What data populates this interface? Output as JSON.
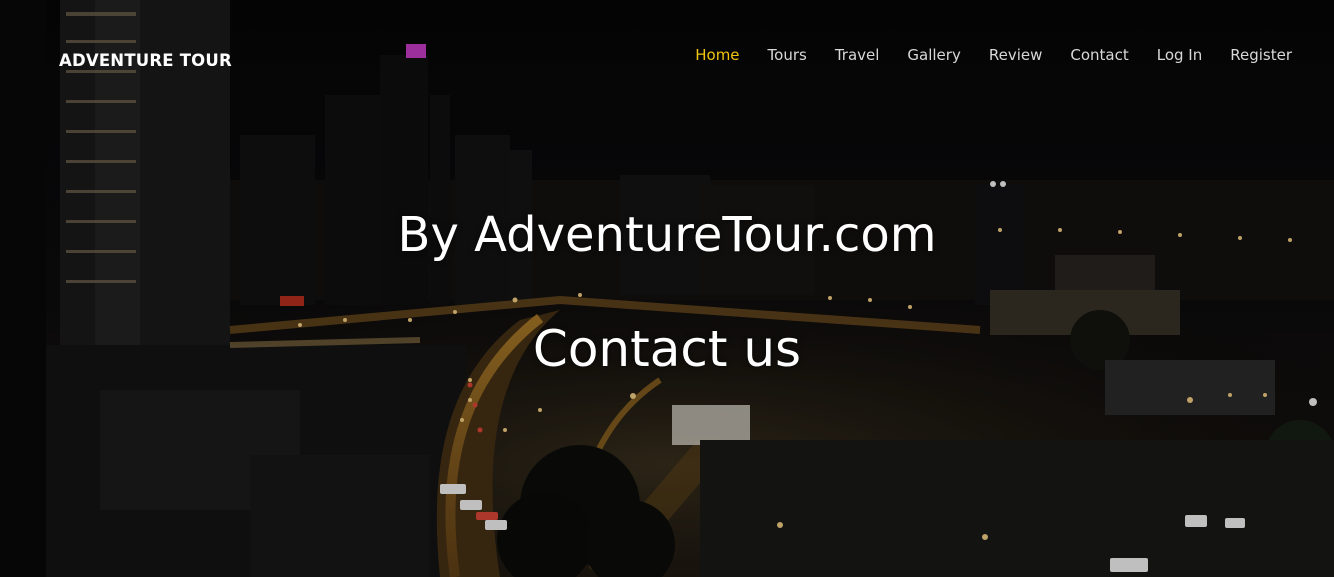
{
  "brand": {
    "name": "ADVENTURE TOUR"
  },
  "nav": {
    "items": [
      {
        "label": "Home",
        "active": true
      },
      {
        "label": "Tours",
        "active": false
      },
      {
        "label": "Travel",
        "active": false
      },
      {
        "label": "Gallery",
        "active": false
      },
      {
        "label": "Review",
        "active": false
      },
      {
        "label": "Contact",
        "active": false
      },
      {
        "label": "Log In",
        "active": false
      },
      {
        "label": "Register",
        "active": false
      }
    ],
    "active_color": "#f1c40f",
    "text_color": "#d8d8d8"
  },
  "hero": {
    "subtitle": "By AdventureTour.com",
    "title": "Contact us"
  }
}
